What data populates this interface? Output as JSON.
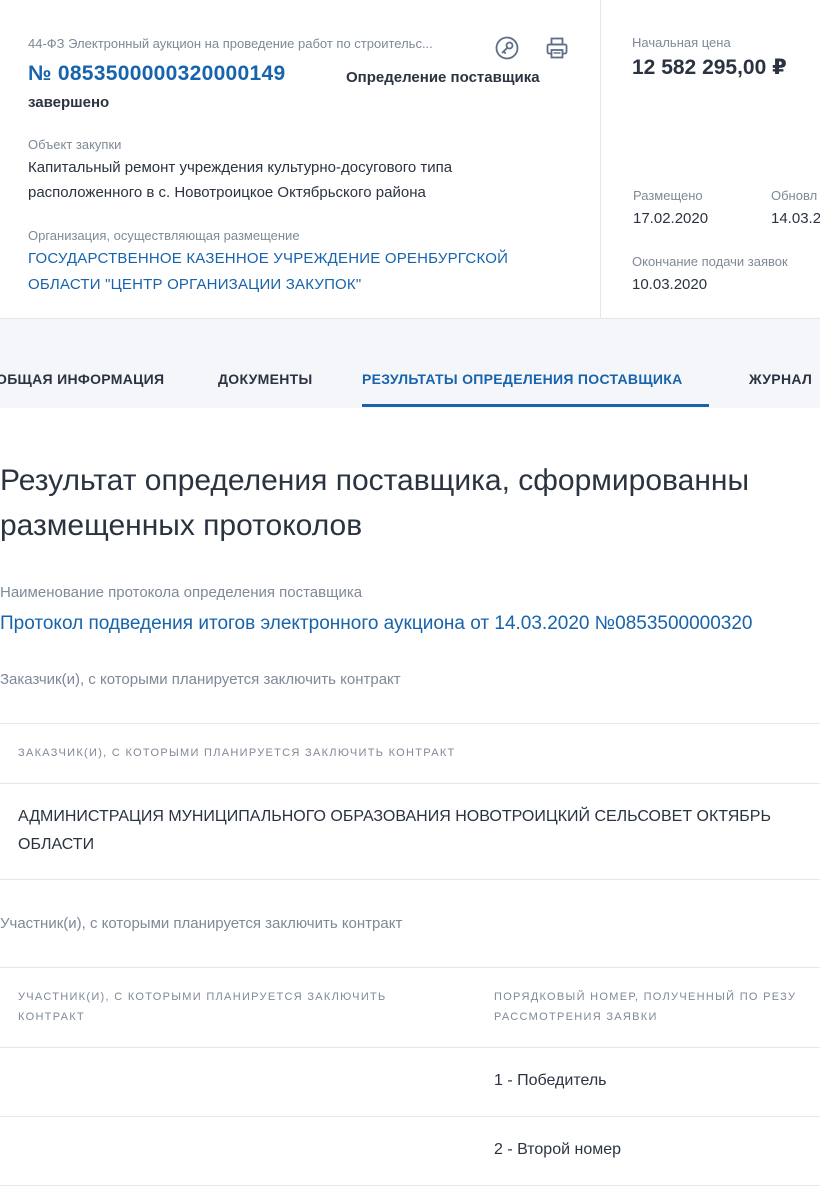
{
  "header": {
    "law_and_method": "44-ФЗ Электронный аукцион на проведение работ по строительс...",
    "registry_number": "№ 0853500000320000149",
    "stage_line1": "Определение поставщика",
    "stage_line2": "завершено",
    "object_label": "Объект закупки",
    "object_line1": "Капитальный ремонт учреждения культурно-досугового типа",
    "object_line2": "расположенного в с. Новотроицкое Октябрьского района",
    "org_label": "Организация, осуществляющая размещение",
    "org_line1": "ГОСУДАРСТВЕННОЕ КАЗЕННОЕ УЧРЕЖДЕНИЕ ОРЕНБУРГСКОЙ",
    "org_line2": "ОБЛАСТИ \"ЦЕНТР ОРГАНИЗАЦИИ ЗАКУПОК\"",
    "icons": {
      "sign": "key-circle-icon",
      "print": "printer-icon"
    }
  },
  "aside": {
    "price_label": "Начальная цена",
    "price_value": "12 582 295,00 ₽",
    "posted_label": "Размещено",
    "posted_value": "17.02.2020",
    "updated_label": "Обновл",
    "updated_value": "14.03.2",
    "deadline_label": "Окончание подачи заявок",
    "deadline_value": "10.03.2020"
  },
  "tabs": [
    {
      "label": "ОБЩАЯ ИНФОРМАЦИЯ"
    },
    {
      "label": "ДОКУМЕНТЫ"
    },
    {
      "label": "РЕЗУЛЬТАТЫ ОПРЕДЕЛЕНИЯ ПОСТАВЩИКА"
    },
    {
      "label": "ЖУРНАЛ"
    }
  ],
  "main": {
    "title_line1": "Результат определения поставщика, сформированны",
    "title_line2": "размещенных протоколов",
    "protocol_label": "Наименование протокола определения поставщика",
    "protocol_link": "Протокол подведения итогов электронного аукциона от 14.03.2020 №0853500000320",
    "customers_section_label": "Заказчик(и), с которыми планируется заключить контракт",
    "customers_table_header": "ЗАКАЗЧИК(И), С КОТОРЫМИ ПЛАНИРУЕТСЯ ЗАКЛЮЧИТЬ КОНТРАКТ",
    "customer_line1": "АДМИНИСТРАЦИЯ МУНИЦИПАЛЬНОГО ОБРАЗОВАНИЯ НОВОТРОИЦКИЙ СЕЛЬСОВЕТ ОКТЯБРЬ",
    "customer_line2": "ОБЛАСТИ",
    "participants_section_label": "Участник(и), с которыми планируется заключить контракт",
    "participants_header_col1_line1": "УЧАСТНИК(И), С КОТОРЫМИ ПЛАНИРУЕТСЯ ЗАКЛЮЧИТЬ",
    "participants_header_col1_line2": "КОНТРАКТ",
    "participants_header_col2_line1": "ПОРЯДКОВЫЙ НОМЕР, ПОЛУЧЕННЫЙ ПО РЕЗУ",
    "participants_header_col2_line2": "РАССМОТРЕНИЯ ЗАЯВКИ",
    "participants_rows": [
      {
        "participant": "",
        "rank": "1 - Победитель"
      },
      {
        "participant": "",
        "rank": "2 - Второй номер"
      }
    ]
  },
  "colors": {
    "accent_blue": "#1763ac",
    "text_dark": "#2b3340",
    "text_muted": "#7f8997",
    "tabs_background": "#f4f6f9",
    "divider": "#e3e7ee"
  }
}
